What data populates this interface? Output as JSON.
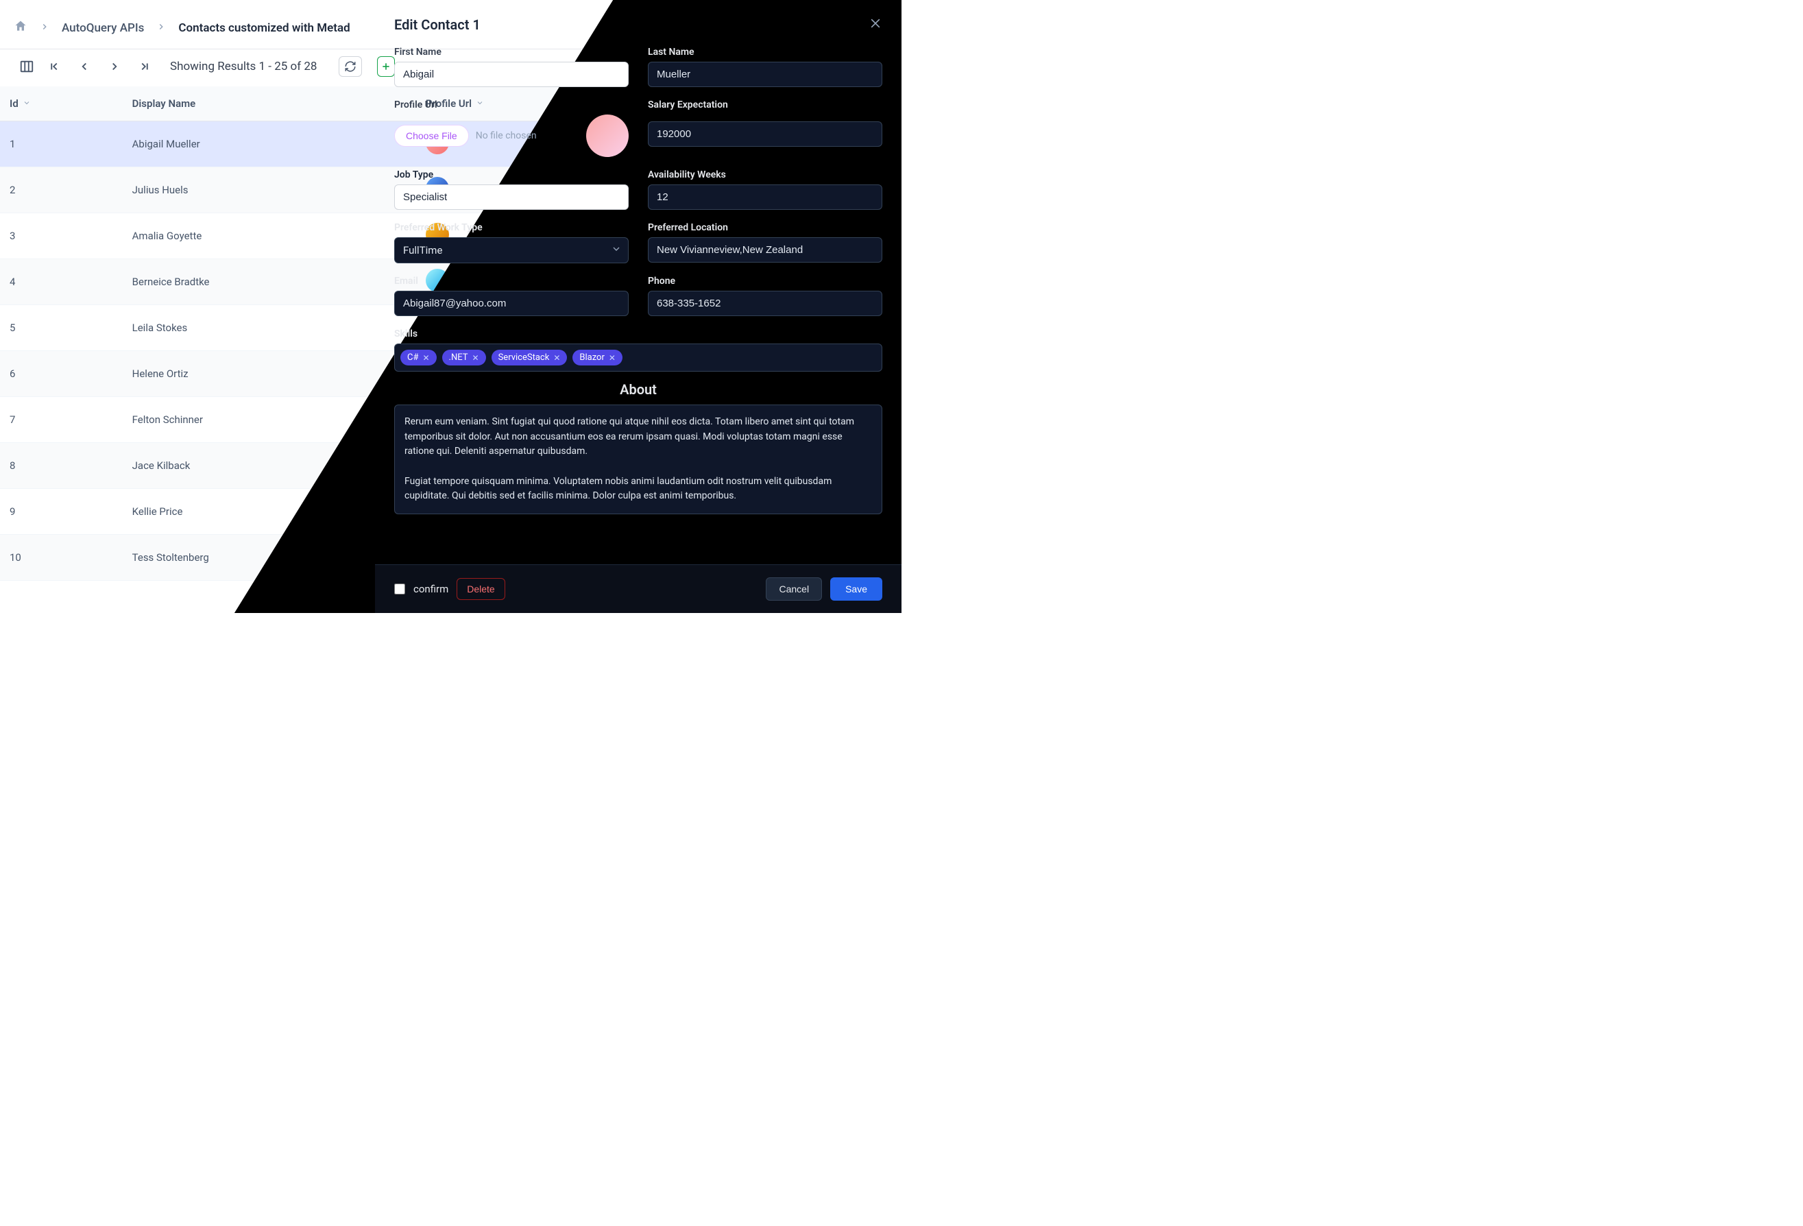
{
  "breadcrumb": {
    "root": "AutoQuery APIs",
    "current": "Contacts customized with Metad"
  },
  "toolbar": {
    "results": "Showing Results 1 - 25 of 28"
  },
  "columns": {
    "id": "Id",
    "displayName": "Display Name",
    "profileUrl": "Profile Url",
    "firstName": "First Name"
  },
  "rows": [
    {
      "id": "1",
      "displayName": "Abigail Mueller",
      "firstName": "Abigail"
    },
    {
      "id": "2",
      "displayName": "Julius Huels",
      "firstName": "Julius"
    },
    {
      "id": "3",
      "displayName": "Amalia Goyette",
      "firstName": "Amalia"
    },
    {
      "id": "4",
      "displayName": "Berneice Bradtke",
      "firstName": "Berneice"
    },
    {
      "id": "5",
      "displayName": "Leila Stokes",
      "firstName": "Leila"
    },
    {
      "id": "6",
      "displayName": "Helene Ortiz",
      "firstName": "Helene"
    },
    {
      "id": "7",
      "displayName": "Felton Schinner",
      "firstName": "Felton"
    },
    {
      "id": "8",
      "displayName": "Jace Kilback",
      "firstName": "Jace"
    },
    {
      "id": "9",
      "displayName": "Kellie Price",
      "firstName": "Kellie"
    },
    {
      "id": "10",
      "displayName": "Tess Stoltenberg",
      "firstName": "Tess"
    }
  ],
  "panel": {
    "title": "Edit Contact 1",
    "labels": {
      "firstName": "First Name",
      "lastName": "Last Name",
      "profileUrl": "Profile Url",
      "salary": "Salary Expectation",
      "jobType": "Job Type",
      "availability": "Availability Weeks",
      "workType": "Preferred Work Type",
      "location": "Preferred Location",
      "email": "Email",
      "phone": "Phone",
      "skills": "Skills",
      "about": "About",
      "chooseFile": "Choose File",
      "noFile": "No file chosen"
    },
    "values": {
      "firstName": "Abigail",
      "lastName": "Mueller",
      "salary": "192000",
      "jobType": "Specialist",
      "availability": "12",
      "workType": "FullTime",
      "location": "New Vivianneview,New Zealand",
      "email": "Abigail87@yahoo.com",
      "phone": "638-335-1652",
      "about": "Rerum eum veniam. Sint fugiat qui quod ratione qui atque nihil eos dicta. Totam libero amet sint qui totam temporibus sit dolor. Aut non accusantium eos ea rerum ipsam quasi. Modi voluptas totam magni esse ratione qui. Deleniti aspernatur quibusdam.\n\nFugiat tempore quisquam minima. Voluptatem nobis animi laudantium odit nostrum velit quibusdam cupiditate. Qui debitis sed et facilis minima. Dolor culpa est animi temporibus."
    },
    "skills": [
      "C#",
      ".NET",
      "ServiceStack",
      "Blazor"
    ],
    "footer": {
      "confirm": "confirm",
      "delete": "Delete",
      "cancel": "Cancel",
      "save": "Save"
    }
  }
}
